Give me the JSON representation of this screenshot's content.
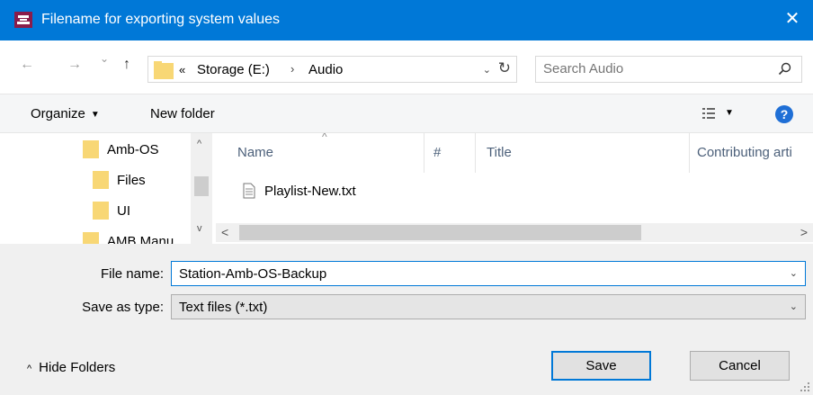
{
  "window": {
    "title": "Filename for exporting system values",
    "close_glyph": "✕"
  },
  "address": {
    "back_glyph": "←",
    "forward_glyph": "→",
    "recent_glyph": "⌄",
    "up_glyph": "↑",
    "overflow": "«",
    "crumbs": [
      "Storage (E:)",
      "Audio"
    ],
    "separator": "›",
    "dropdown_glyph": "⌄",
    "refresh_glyph": "↻"
  },
  "search": {
    "placeholder": "Search Audio"
  },
  "toolbar": {
    "organize_label": "Organize",
    "organize_caret": "▼",
    "new_folder_label": "New folder",
    "views_caret": "▼",
    "help_label": "?"
  },
  "navpane": {
    "items": [
      {
        "label": "Amb-OS"
      },
      {
        "label": "Files"
      },
      {
        "label": "UI"
      },
      {
        "label": "AMB Manu"
      }
    ],
    "scroll_up": "^",
    "scroll_down": "v"
  },
  "filelist": {
    "columns": [
      {
        "label": "Name"
      },
      {
        "label": "#"
      },
      {
        "label": "Title"
      },
      {
        "label": "Contributing arti"
      }
    ],
    "sort_indicator": "^",
    "files": [
      {
        "name": "Playlist-New.txt",
        "icon": "text-file-icon"
      }
    ],
    "scroll_left": "<",
    "scroll_right": ">"
  },
  "form": {
    "filename_label": "File name:",
    "filename_value": "Station-Amb-OS-Backup",
    "type_label": "Save as type:",
    "type_value": "Text files (*.txt)",
    "chevron": "⌄"
  },
  "footer": {
    "hide_folders_caret": "^",
    "hide_folders_label": "Hide Folders",
    "save_label": "Save",
    "cancel_label": "Cancel"
  },
  "colors": {
    "titlebar": "#0078d7",
    "folder": "#f8d775",
    "help": "#1f6fd6"
  }
}
